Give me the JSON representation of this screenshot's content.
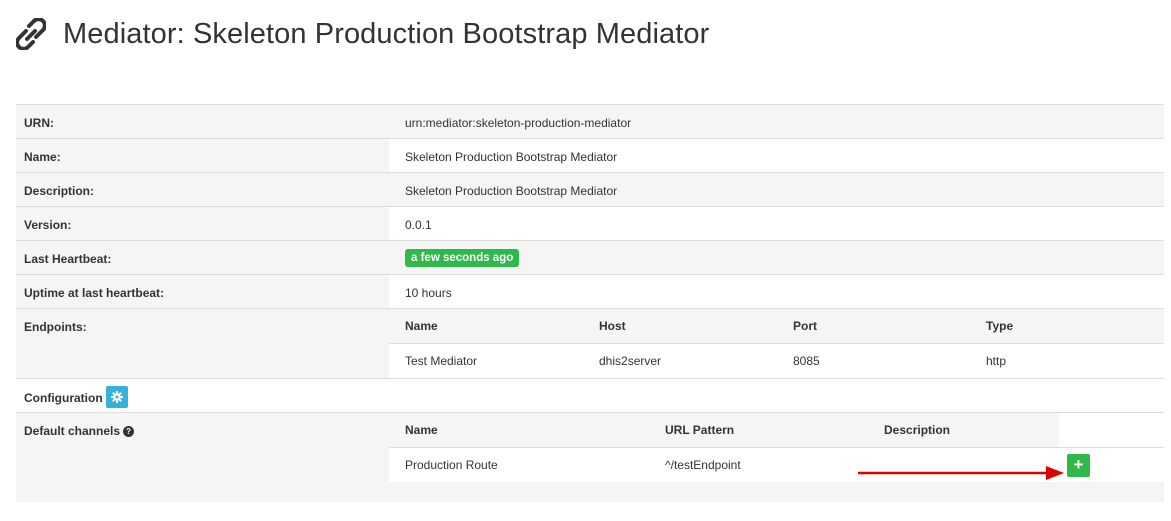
{
  "page": {
    "title": "Mediator: Skeleton Production Bootstrap Mediator",
    "title_icon": "link-icon"
  },
  "details": {
    "urn": {
      "label": "URN:",
      "value": "urn:mediator:skeleton-production-mediator"
    },
    "name": {
      "label": "Name:",
      "value": "Skeleton Production Bootstrap Mediator"
    },
    "description": {
      "label": "Description:",
      "value": "Skeleton Production Bootstrap Mediator"
    },
    "version": {
      "label": "Version:",
      "value": "0.0.1"
    },
    "last_heartbeat": {
      "label": "Last Heartbeat:",
      "value": "a few seconds ago",
      "badge_color": "#2eb94a"
    },
    "uptime": {
      "label": "Uptime at last heartbeat:",
      "value": "10 hours"
    }
  },
  "endpoints": {
    "label": "Endpoints:",
    "columns": [
      "Name",
      "Host",
      "Port",
      "Type"
    ],
    "rows": [
      {
        "name": "Test Mediator",
        "host": "dhis2server",
        "port": "8085",
        "type": "http"
      }
    ]
  },
  "configuration": {
    "label": "Configuration",
    "button_icon": "gear-icon",
    "button_color": "#36b1dc"
  },
  "default_channels": {
    "label": "Default channels",
    "help_icon": "question-circle-icon",
    "columns": [
      "Name",
      "URL Pattern",
      "Description"
    ],
    "rows": [
      {
        "name": "Production Route",
        "url_pattern": "^/testEndpoint",
        "description": "",
        "action_icon": "plus-icon"
      }
    ]
  },
  "colors": {
    "success": "#2eb94a",
    "info": "#36b1dc",
    "annotation_arrow": "#e00000"
  }
}
